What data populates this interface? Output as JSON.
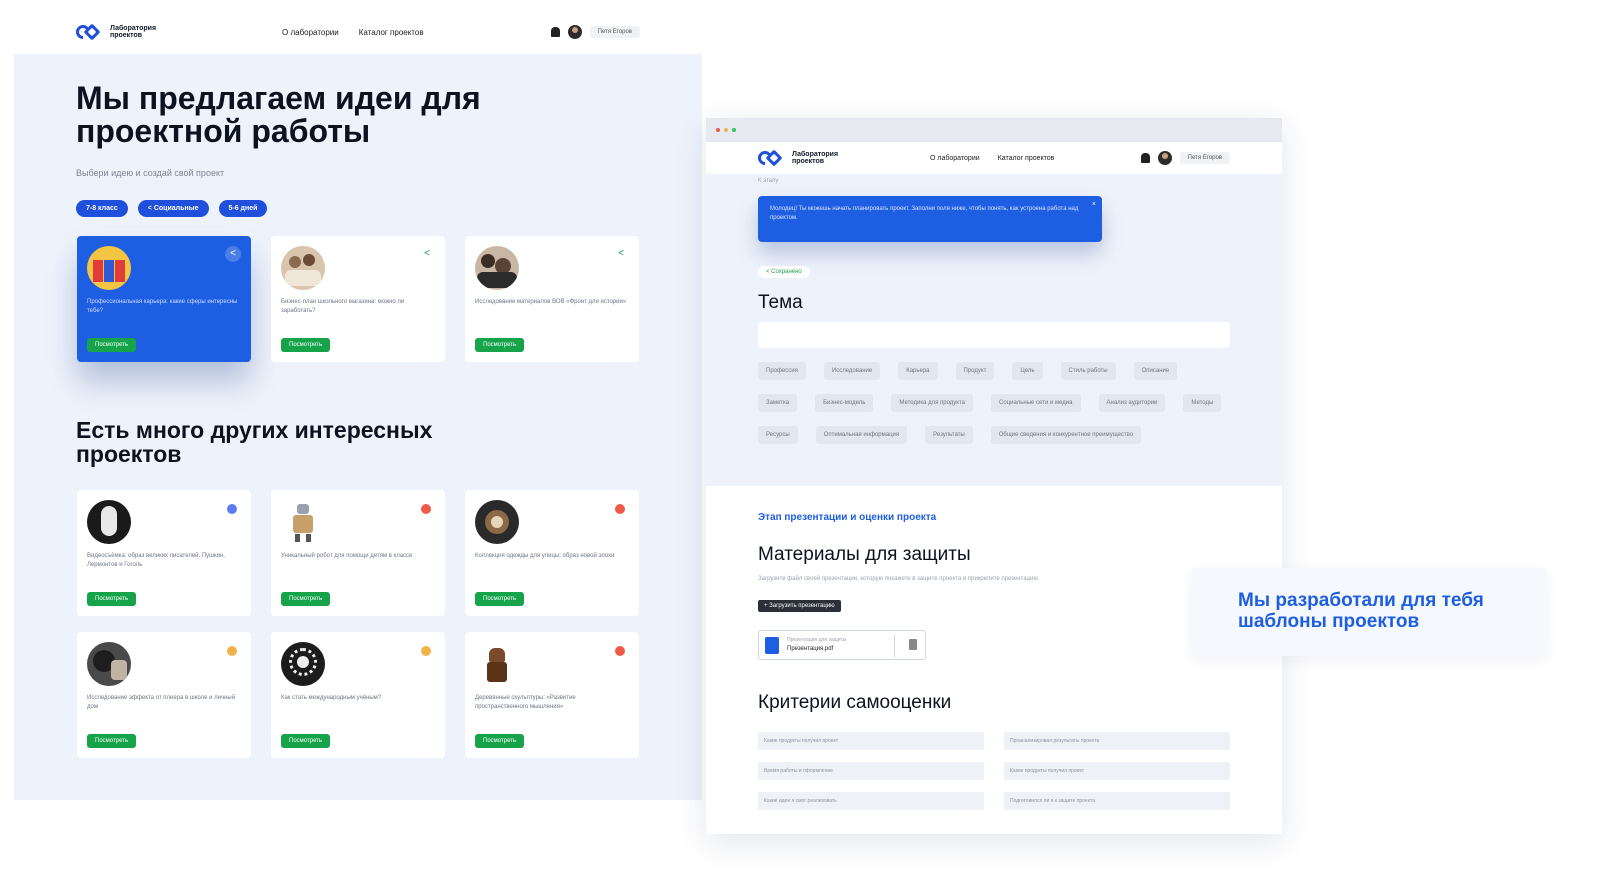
{
  "left": {
    "logo_text": "Лаборатория проектов",
    "nav": [
      "О лаборатории",
      "Каталог проектов"
    ],
    "user": "Петя Егоров",
    "hero_title": "Мы предлагаем идеи для проектной работы",
    "hero_subtitle": "Выбери идею и создай свой проект",
    "filters": [
      "7-8 класс",
      "< Социальные",
      "5-6 дней"
    ],
    "featured": [
      {
        "desc": "Профессиональная карьера: какие сферы интересны тебе?",
        "button": "Посмотреть"
      },
      {
        "desc": "Бизнес-план школьного магазина: можно ли заработать?",
        "button": "Посмотреть"
      },
      {
        "desc": "Исследование материалов ВОВ «Фронт для истории»",
        "button": "Посмотреть"
      }
    ],
    "section2_title": "Есть много других интересных проектов",
    "projects": [
      {
        "desc": "Видеосъёмка: образ великих писателей. Пушкин, Лермонтов и Гоголь",
        "button": "Посмотреть",
        "dot_color": "#5b7cf0"
      },
      {
        "desc": "Уникальный робот для помощи детям в классе",
        "button": "Посмотреть",
        "dot_color": "#ef5a4a"
      },
      {
        "desc": "Коллекция одежды для улицы: образ новой эпохи",
        "button": "Посмотреть",
        "dot_color": "#ef5a4a"
      },
      {
        "desc": "Исследование эффекта от плеера в школе и личный дом",
        "button": "Посмотреть",
        "dot_color": "#f2b24a"
      },
      {
        "desc": "Как стать международным учёным?",
        "button": "Посмотреть",
        "dot_color": "#f2b24a"
      },
      {
        "desc": "Деревянные скульптуры: «Развитие пространственного мышления»",
        "button": "Посмотреть",
        "dot_color": "#ef5a4a"
      }
    ]
  },
  "right": {
    "logo_text": "Лаборатория проектов",
    "nav": [
      "О лаборатории",
      "Каталог проектов"
    ],
    "user": "Петя Егоров",
    "breadcrumb": "К этапу",
    "toast": "Молодец! Ты можешь начать планировать проект. Заполни поля ниже, чтобы понять, как устроена работа над проектом.",
    "toast_close": "×",
    "back": "< Сохранено",
    "tema_title": "Тема",
    "tags_row1": [
      "Профессия",
      "Исследование",
      "Карьера",
      "Продукт",
      "Цель",
      "Стиль работы",
      "Описание"
    ],
    "tags_row2": [
      "Заметка",
      "Бизнес-модель",
      "Методика для продукта",
      "Социальные сети и медиа",
      "Анализ аудитории"
    ],
    "tags_row3": [
      "Методы",
      "Ресурсы",
      "Оптимальная информация",
      "Результаты",
      "Общие сведения и конкурентное преимущество"
    ],
    "stage_label": "Этап презентации и оценки проекта",
    "materials_title": "Материалы для защиты",
    "materials_desc": "Загрузите файл своей презентации, которую покажете в защите проекта и прикрепите презентацию",
    "materials_tag": "+ Загрузить презентацию",
    "file_label": "Презентация для защиты",
    "file_name": "Презентация.pdf",
    "criteria_title": "Критерии самооценки",
    "criteria": [
      "Какие продукты получил проект",
      "Проанализировал результаты проекта",
      "Время работы и оформление",
      "Какие продукты получил проект",
      "Какие идеи я смог реализовать",
      "Подготовился ли я к защите проекта"
    ]
  },
  "callout": {
    "text": "Мы разработали для тебя шаблоны проектов"
  },
  "colors": {
    "accent": "#1d5ee2",
    "go_button": "#16a34a",
    "page_bg": "#eef3fb"
  }
}
